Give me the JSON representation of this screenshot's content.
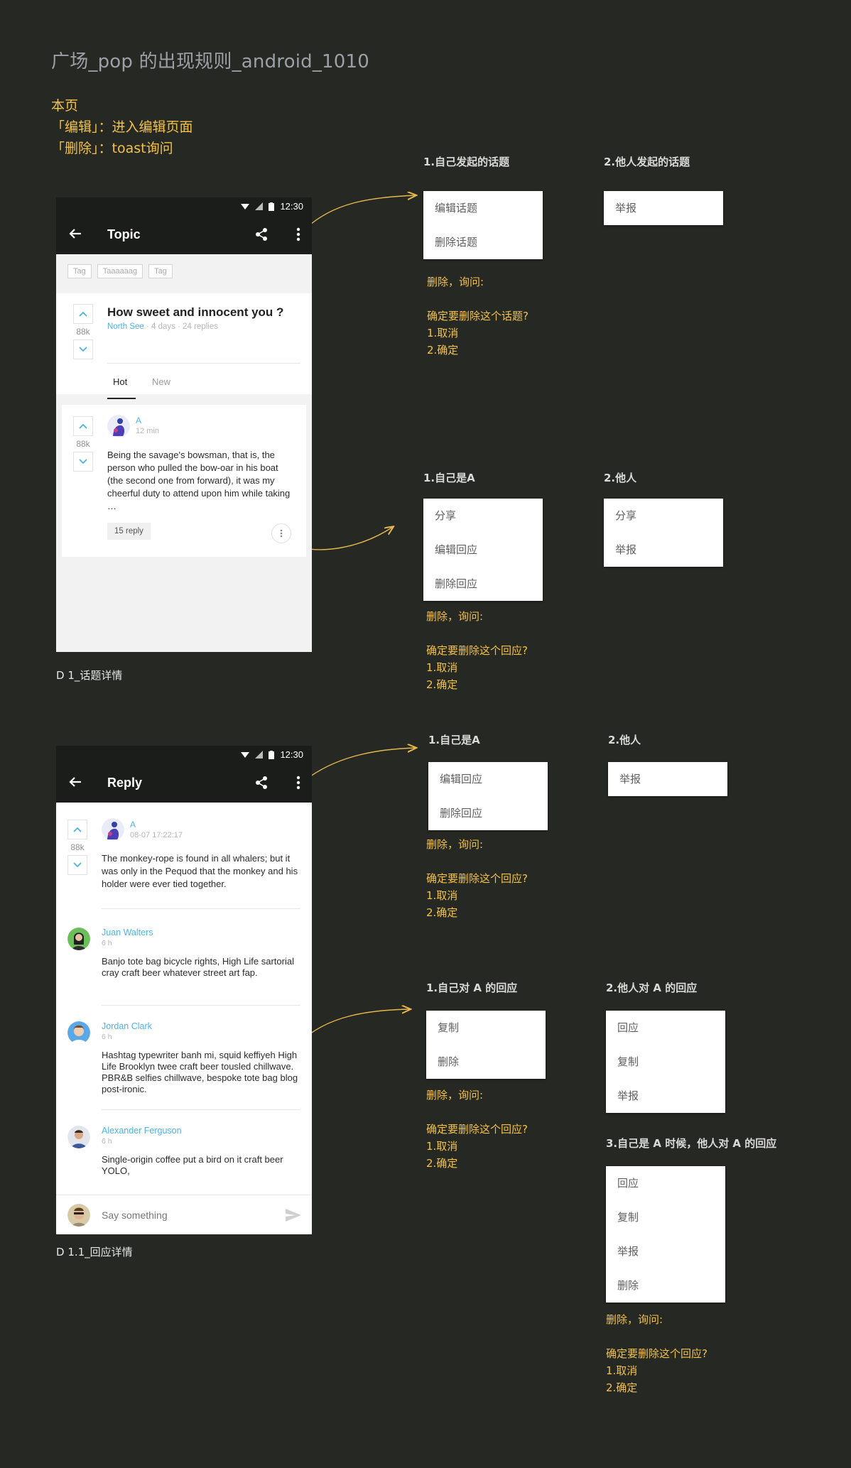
{
  "page": {
    "title": "广场_pop 的出现规则_android_1010",
    "notes": [
      "本页",
      "「编辑」：进入编辑页面",
      "「删除」：toast询问"
    ]
  },
  "phone1": {
    "status_time": "12:30",
    "app_title": "Topic",
    "tags": [
      "Tag",
      "Taaaaaag",
      "Tag"
    ],
    "topic": {
      "title": "How sweet and innocent you ?",
      "author": "North See",
      "meta": " · 4 days · 24 replies",
      "votes": "88k"
    },
    "tabs": [
      "Hot",
      "New"
    ],
    "reply": {
      "author": "A",
      "time": "12 min",
      "votes": "88k",
      "text": "Being the savage's bowsman, that is, the person who pulled the bow-oar in his boat (the second one from forward), it was my cheerful duty to attend upon him while taking  …",
      "reply_count": "15 reply"
    },
    "caption": "D 1_话题详情"
  },
  "phone2": {
    "status_time": "12:30",
    "app_title": "Reply",
    "main": {
      "author": "A",
      "time": "08-07 17:22:17",
      "votes": "88k",
      "text": "The monkey-rope is found in all whalers; but it was only in the Pequod that the monkey and his holder were ever tied together."
    },
    "replies": [
      {
        "name": "Juan Walters",
        "time": "6 h",
        "text": "Banjo tote bag bicycle rights, High Life sartorial cray craft beer whatever street art fap."
      },
      {
        "name": "Jordan Clark",
        "time": "6 h",
        "text": "Hashtag typewriter banh mi, squid keffiyeh High Life Brooklyn twee craft beer tousled chillwave. PBR&B selfies chillwave, bespoke tote bag blog post-ironic."
      },
      {
        "name": "Alexander Ferguson",
        "time": "6 h",
        "text": "Single-origin coffee put a bird on it craft beer YOLO,"
      }
    ],
    "input_placeholder": "Say something",
    "caption": "D 1.1_回应详情"
  },
  "section1": {
    "a_heading": "1.自己发起的话题",
    "a_items": [
      "编辑话题",
      "删除话题"
    ],
    "a_note": [
      "删除，询问:",
      "确定要删除这个话题?",
      "1.取消",
      "2.确定"
    ],
    "b_heading": "2.他人发起的话题",
    "b_items": [
      "举报"
    ]
  },
  "section2": {
    "a_heading": "1.自己是A",
    "a_items": [
      "分享",
      "编辑回应",
      "删除回应"
    ],
    "a_note": [
      "删除，询问:",
      "确定要删除这个回应?",
      "1.取消",
      "2.确定"
    ],
    "b_heading": "2.他人",
    "b_items": [
      "分享",
      "举报"
    ]
  },
  "section3": {
    "a_heading": "1.自己是A",
    "a_items": [
      "编辑回应",
      "删除回应"
    ],
    "a_note": [
      "删除，询问:",
      "确定要删除这个回应?",
      "1.取消",
      "2.确定"
    ],
    "b_heading": "2.他人",
    "b_items": [
      "举报"
    ]
  },
  "section4": {
    "a_heading": "1.自己对 A 的回应",
    "a_items": [
      "复制",
      "删除"
    ],
    "a_note": [
      "删除，询问:",
      "确定要删除这个回应?",
      "1.取消",
      "2.确定"
    ],
    "b_heading": "2.他人对 A 的回应",
    "b_items": [
      "回应",
      "复制",
      "举报"
    ],
    "c_heading": "3.自己是 A 时候，他人对 A 的回应",
    "c_items": [
      "回应",
      "复制",
      "举报",
      "删除"
    ],
    "c_note": [
      "删除，询问:",
      "确定要删除这个回应?",
      "1.取消",
      "2.确定"
    ]
  },
  "colors": {
    "background": "#262823",
    "note_yellow": "#f2c24a",
    "arrow": "#e7b84e",
    "link_blue": "#4fb0e6",
    "app_bar": "#1b1d1a"
  }
}
